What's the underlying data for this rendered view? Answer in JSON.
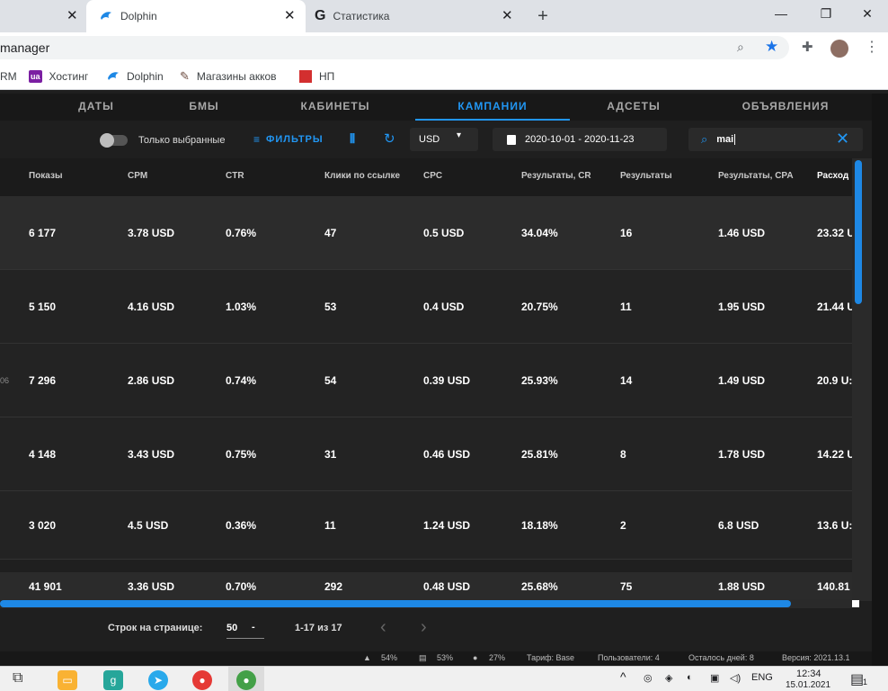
{
  "browser": {
    "tabs": [
      {
        "label": "",
        "active": false
      },
      {
        "label": "Dolphin",
        "active": true
      },
      {
        "label": "Статистика",
        "active": false
      }
    ],
    "new_tab": "+",
    "window": {
      "minimize": "—",
      "maximize": "❐",
      "close": "✕"
    },
    "address": "manager",
    "bookmarks": [
      {
        "label": "RM"
      },
      {
        "label": "Хостинг",
        "icon_text": "ua"
      },
      {
        "label": "Dolphin"
      },
      {
        "label": "Магазины акков"
      },
      {
        "label": "НП"
      }
    ]
  },
  "nav": {
    "tabs": [
      "ДАТЫ",
      "БМЫ",
      "КАБИНЕТЫ",
      "КАМПАНИИ",
      "АДСЕТЫ",
      "ОБЪЯВЛЕНИЯ"
    ],
    "active": "КАМПАНИИ"
  },
  "filters": {
    "only_selected_label": "Только выбранные",
    "filters_label": "ФИЛЬТРЫ",
    "currency": "USD",
    "date_range": "2020-10-01 - 2020-11-23",
    "search_value": "mai"
  },
  "table": {
    "columns": [
      "Показы",
      "CPM",
      "CTR",
      "Клики по ссылке",
      "CPC",
      "Результаты, CR",
      "Результаты",
      "Результаты, CPA",
      "Расход"
    ],
    "rows": [
      {
        "prefix": "",
        "cells": [
          "6 177",
          "3.78 USD",
          "0.76%",
          "47",
          "0.5 USD",
          "34.04%",
          "16",
          "1.46 USD",
          "23.32 U"
        ]
      },
      {
        "prefix": "",
        "cells": [
          "5 150",
          "4.16 USD",
          "1.03%",
          "53",
          "0.4 USD",
          "20.75%",
          "11",
          "1.95 USD",
          "21.44 U"
        ]
      },
      {
        "prefix": "06",
        "cells": [
          "7 296",
          "2.86 USD",
          "0.74%",
          "54",
          "0.39 USD",
          "25.93%",
          "14",
          "1.49 USD",
          "20.9 U:"
        ]
      },
      {
        "prefix": "",
        "cells": [
          "4 148",
          "3.43 USD",
          "0.75%",
          "31",
          "0.46 USD",
          "25.81%",
          "8",
          "1.78 USD",
          "14.22 U"
        ]
      },
      {
        "prefix": "",
        "cells": [
          "3 020",
          "4.5 USD",
          "0.36%",
          "11",
          "1.24 USD",
          "18.18%",
          "2",
          "6.8 USD",
          "13.6 U:"
        ]
      }
    ],
    "totals": [
      "41 901",
      "3.36 USD",
      "0.70%",
      "292",
      "0.48 USD",
      "25.68%",
      "75",
      "1.88 USD",
      "140.81"
    ]
  },
  "pagination": {
    "rows_per_page_label": "Строк на странице:",
    "rows_per_page": "50",
    "dropdown_caret": "-",
    "range": "1-17 из 17",
    "prev": "‹",
    "next": "›"
  },
  "status_bar": {
    "cpu": "54%",
    "ram": "53%",
    "disk": "27%",
    "tariff": "Тариф: Base",
    "users": "Пользователи: 4",
    "days_left": "Осталось дней: 8",
    "version": "Версия: 2021.13.1"
  },
  "taskbar": {
    "lang": "ENG",
    "time": "12:34",
    "date": "15.01.2021",
    "notif_count": "1"
  },
  "colors": {
    "accent": "#2196f3",
    "bg": "#1f1f1f",
    "row_highlight": "#2c2c2c"
  }
}
